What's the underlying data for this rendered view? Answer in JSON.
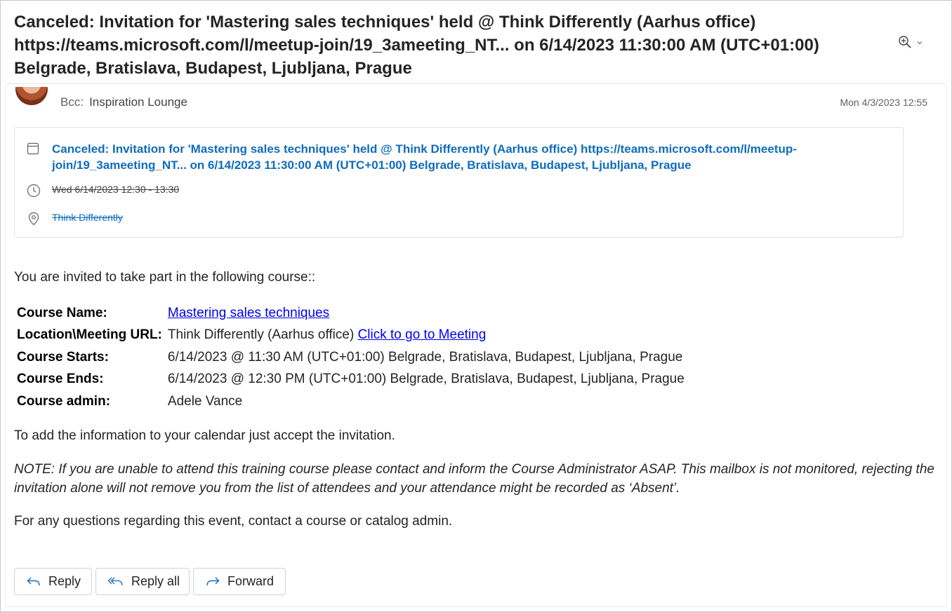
{
  "subject": "Canceled: Invitation for 'Mastering sales techniques' held @ Think Differently (Aarhus office) https://teams.microsoft.com/l/meetup-join/19_3ameeting_NT... on 6/14/2023 11:30:00 AM (UTC+01:00) Belgrade, Bratislava, Budapest, Ljubljana, Prague",
  "header": {
    "bcc_label": "Bcc:",
    "bcc_value": "Inspiration Lounge",
    "date": "Mon 4/3/2023 12:55"
  },
  "event": {
    "title": "Canceled: Invitation for 'Mastering sales techniques' held @ Think Differently (Aarhus office) https://teams.microsoft.com/l/meetup-join/19_3ameeting_NT... on 6/14/2023 11:30:00 AM (UTC+01:00) Belgrade, Bratislava, Budapest, Ljubljana, Prague",
    "time": "Wed 6/14/2023 12:30 - 13:30",
    "location": "Think Differently"
  },
  "body": {
    "intro": "You are invited to take part in the following course::",
    "course": {
      "name_label": "Course Name:",
      "name_value": "Mastering sales techniques",
      "location_label": "Location\\Meeting URL:",
      "location_value": "Think Differently (Aarhus office)",
      "meeting_link": "Click to go to Meeting",
      "starts_label": "Course Starts:",
      "starts_value": "6/14/2023 @ 11:30 AM (UTC+01:00) Belgrade, Bratislava, Budapest, Ljubljana, Prague",
      "ends_label": "Course Ends:",
      "ends_value": "6/14/2023 @ 12:30 PM (UTC+01:00) Belgrade, Bratislava, Budapest, Ljubljana, Prague",
      "admin_label": "Course admin:",
      "admin_value": "Adele Vance"
    },
    "accept_text": "To add the information to your calendar just accept the invitation.",
    "note": "NOTE: If you are unable to attend this training course please contact and inform the Course Administrator ASAP. This mailbox is not monitored, rejecting the invitation alone will not remove you from the list of attendees and your attendance might be recorded as ‘Absent’.",
    "questions": "For any questions regarding this event, contact a course or catalog admin."
  },
  "actions": {
    "reply": "Reply",
    "reply_all": "Reply all",
    "forward": "Forward"
  },
  "icons": {
    "zoom": "zoom-in-icon",
    "calendar": "calendar-icon",
    "clock": "clock-icon",
    "location": "location-pin-icon"
  },
  "colors": {
    "event_link": "#0f6cbd",
    "hyperlink": "#0000ee",
    "text": "#242424"
  }
}
